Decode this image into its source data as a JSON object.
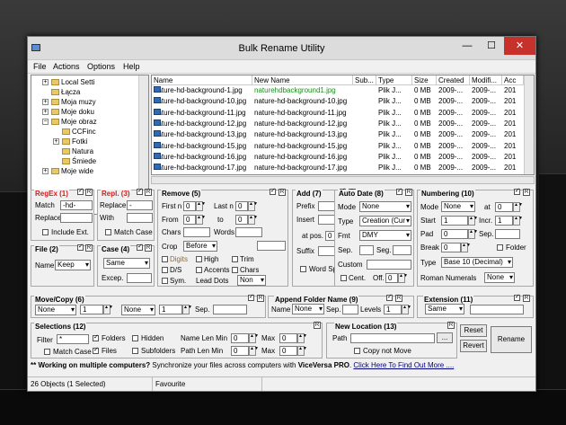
{
  "window": {
    "title": "Bulk Rename Utility",
    "minimize": "—",
    "maximize": "☐",
    "close": "✕"
  },
  "menu": [
    "File",
    "Actions",
    "Options",
    "Help"
  ],
  "tree": [
    {
      "label": "Local Setti",
      "indent": 0,
      "pm": "+"
    },
    {
      "label": "Łącza",
      "indent": 0,
      "pm": ""
    },
    {
      "label": "Moja muzy",
      "indent": 0,
      "pm": "+"
    },
    {
      "label": "Moje doku",
      "indent": 0,
      "pm": "+"
    },
    {
      "label": "Moje obraz",
      "indent": 0,
      "pm": "−"
    },
    {
      "label": "CCFinc",
      "indent": 1,
      "pm": ""
    },
    {
      "label": "Fotki",
      "indent": 1,
      "pm": "+"
    },
    {
      "label": "Natura",
      "indent": 1,
      "pm": ""
    },
    {
      "label": "Śmiede",
      "indent": 1,
      "pm": ""
    },
    {
      "label": "Moje wide",
      "indent": 0,
      "pm": "+"
    }
  ],
  "list": {
    "headers": [
      "Name",
      "New Name",
      "Sub...",
      "Type",
      "Size",
      "Created",
      "Modifi...",
      "Acc"
    ],
    "rows": [
      {
        "name": "nature-hd-background-1.jpg",
        "new": "naturehdbackground1.jpg",
        "type": "Plik J...",
        "size": "0 MB",
        "created": "2009-...",
        "mod": "2009-...",
        "acc": "201",
        "changed": true
      },
      {
        "name": "nature-hd-background-10.jpg",
        "new": "nature-hd-background-10.jpg",
        "type": "Plik J...",
        "size": "0 MB",
        "created": "2009-...",
        "mod": "2009-...",
        "acc": "201",
        "changed": false
      },
      {
        "name": "nature-hd-background-11.jpg",
        "new": "nature-hd-background-11.jpg",
        "type": "Plik J...",
        "size": "0 MB",
        "created": "2009-...",
        "mod": "2009-...",
        "acc": "201",
        "changed": false
      },
      {
        "name": "nature-hd-background-12.jpg",
        "new": "nature-hd-background-12.jpg",
        "type": "Plik J...",
        "size": "0 MB",
        "created": "2009-...",
        "mod": "2009-...",
        "acc": "201",
        "changed": false
      },
      {
        "name": "nature-hd-background-13.jpg",
        "new": "nature-hd-background-13.jpg",
        "type": "Plik J...",
        "size": "0 MB",
        "created": "2009-...",
        "mod": "2009-...",
        "acc": "201",
        "changed": false
      },
      {
        "name": "nature-hd-background-15.jpg",
        "new": "nature-hd-background-15.jpg",
        "type": "Plik J...",
        "size": "0 MB",
        "created": "2009-...",
        "mod": "2009-...",
        "acc": "201",
        "changed": false
      },
      {
        "name": "nature-hd-background-16.jpg",
        "new": "nature-hd-background-16.jpg",
        "type": "Plik J...",
        "size": "0 MB",
        "created": "2009-...",
        "mod": "2009-...",
        "acc": "201",
        "changed": false
      },
      {
        "name": "nature-hd-background-17.jpg",
        "new": "nature-hd-background-17.jpg",
        "type": "Plik J...",
        "size": "0 MB",
        "created": "2009-...",
        "mod": "2009-...",
        "acc": "201",
        "changed": false
      }
    ]
  },
  "regex": {
    "title": "RegEx (1)",
    "match_label": "Match",
    "match": "-hd-",
    "replace_label": "Replace",
    "replace": "",
    "include_ext": "Include Ext."
  },
  "repl": {
    "title": "Repl. (3)",
    "replace_label": "Replace",
    "replace": "-",
    "with_label": "With",
    "with": "",
    "match_case": "Match Case"
  },
  "remove": {
    "title": "Remove (5)",
    "firstn": "First n",
    "firstn_v": "0",
    "lastn": "Last n",
    "lastn_v": "0",
    "from": "From",
    "from_v": "0",
    "to": "to",
    "to_v": "0",
    "chars": "Chars",
    "words": "Words",
    "crop": "Crop",
    "crop_v": "Before",
    "digits": "Digits",
    "high": "High",
    "trim": "Trim",
    "ds": "D/S",
    "accents": "Accents",
    "chars2": "Chars",
    "sym": "Sym.",
    "lead_dots": "Lead Dots",
    "lead_v": "Non"
  },
  "add": {
    "title": "Add (7)",
    "prefix": "Prefix",
    "insert": "Insert",
    "atpos": "at pos.",
    "atpos_v": "0",
    "suffix": "Suffix",
    "word_space": "Word Space"
  },
  "autodate": {
    "title": "Auto Date (8)",
    "mode": "Mode",
    "mode_v": "None",
    "type": "Type",
    "type_v": "Creation (Cur",
    "fmt": "Fmt",
    "fmt_v": "DMY",
    "sep": "Sep.",
    "seg": "Seg.",
    "custom": "Custom",
    "cent": "Cent.",
    "off": "Off.",
    "off_v": "0"
  },
  "numbering": {
    "title": "Numbering (10)",
    "mode": "Mode",
    "mode_v": "None",
    "at": "at",
    "at_v": "0",
    "start": "Start",
    "start_v": "1",
    "incr": "Incr.",
    "incr_v": "1",
    "pad": "Pad",
    "pad_v": "0",
    "sep": "Sep.",
    "break": "Break",
    "break_v": "0",
    "folder": "Folder",
    "type": "Type",
    "type_v": "Base 10 (Decimal)",
    "roman": "Roman Numerals",
    "roman_v": "None"
  },
  "file": {
    "title": "File (2)",
    "name": "Name",
    "name_v": "Keep"
  },
  "case": {
    "title": "Case (4)",
    "case_v": "Same",
    "excep": "Excep."
  },
  "movecopy": {
    "title": "Move/Copy (6)",
    "a": "None",
    "b": "1",
    "c": "None",
    "d": "1",
    "sep": "Sep."
  },
  "append": {
    "title": "Append Folder Name (9)",
    "name": "Name",
    "name_v": "None",
    "sep": "Sep.",
    "levels": "Levels",
    "levels_v": "1"
  },
  "extension": {
    "title": "Extension (11)",
    "v": "Same"
  },
  "selections": {
    "title": "Selections (12)",
    "filter": "Filter",
    "filter_v": "*",
    "folders": "Folders",
    "hidden": "Hidden",
    "namemin": "Name Len Min",
    "namemin_v": "0",
    "max": "Max",
    "max_v": "0",
    "matchcase": "Match Case",
    "files": "Files",
    "subfolders": "Subfolders",
    "pathmin": "Path Len Min",
    "pathmin_v": "0",
    "max2_v": "0"
  },
  "newloc": {
    "title": "New Location (13)",
    "path": "Path",
    "browse": "...",
    "copy": "Copy not Move"
  },
  "buttons": {
    "reset": "Reset",
    "revert": "Revert",
    "rename": "Rename",
    "r": "R"
  },
  "promo": {
    "bold": "** Working on multiple computers?",
    "text": " Synchronize your files across computers with ",
    "brand": "ViceVersa PRO",
    "link": "Click Here To Find Out More ...."
  },
  "status": {
    "objects": "26 Objects (1 Selected)",
    "fav": "Favourite"
  },
  "colors": {
    "green": "#1a8f1a",
    "red": "#d02020",
    "link": "#000080"
  }
}
